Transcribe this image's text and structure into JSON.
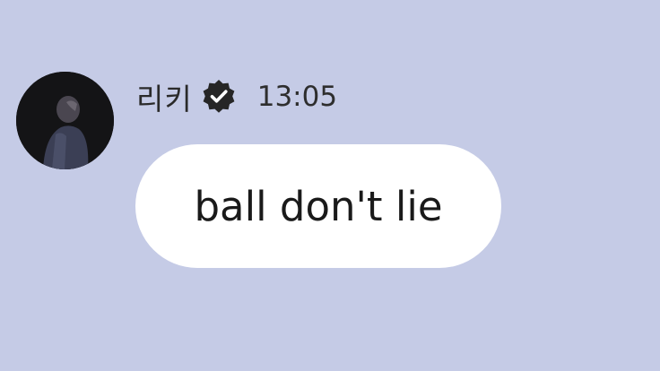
{
  "chat": {
    "message": {
      "sender_name": "리키",
      "verified_icon": "verified-badge-icon",
      "timestamp": "13:05",
      "text": "ball don't lie"
    }
  },
  "colors": {
    "background": "#c5cbe6",
    "bubble": "#ffffff",
    "text": "#1a1a1a"
  }
}
